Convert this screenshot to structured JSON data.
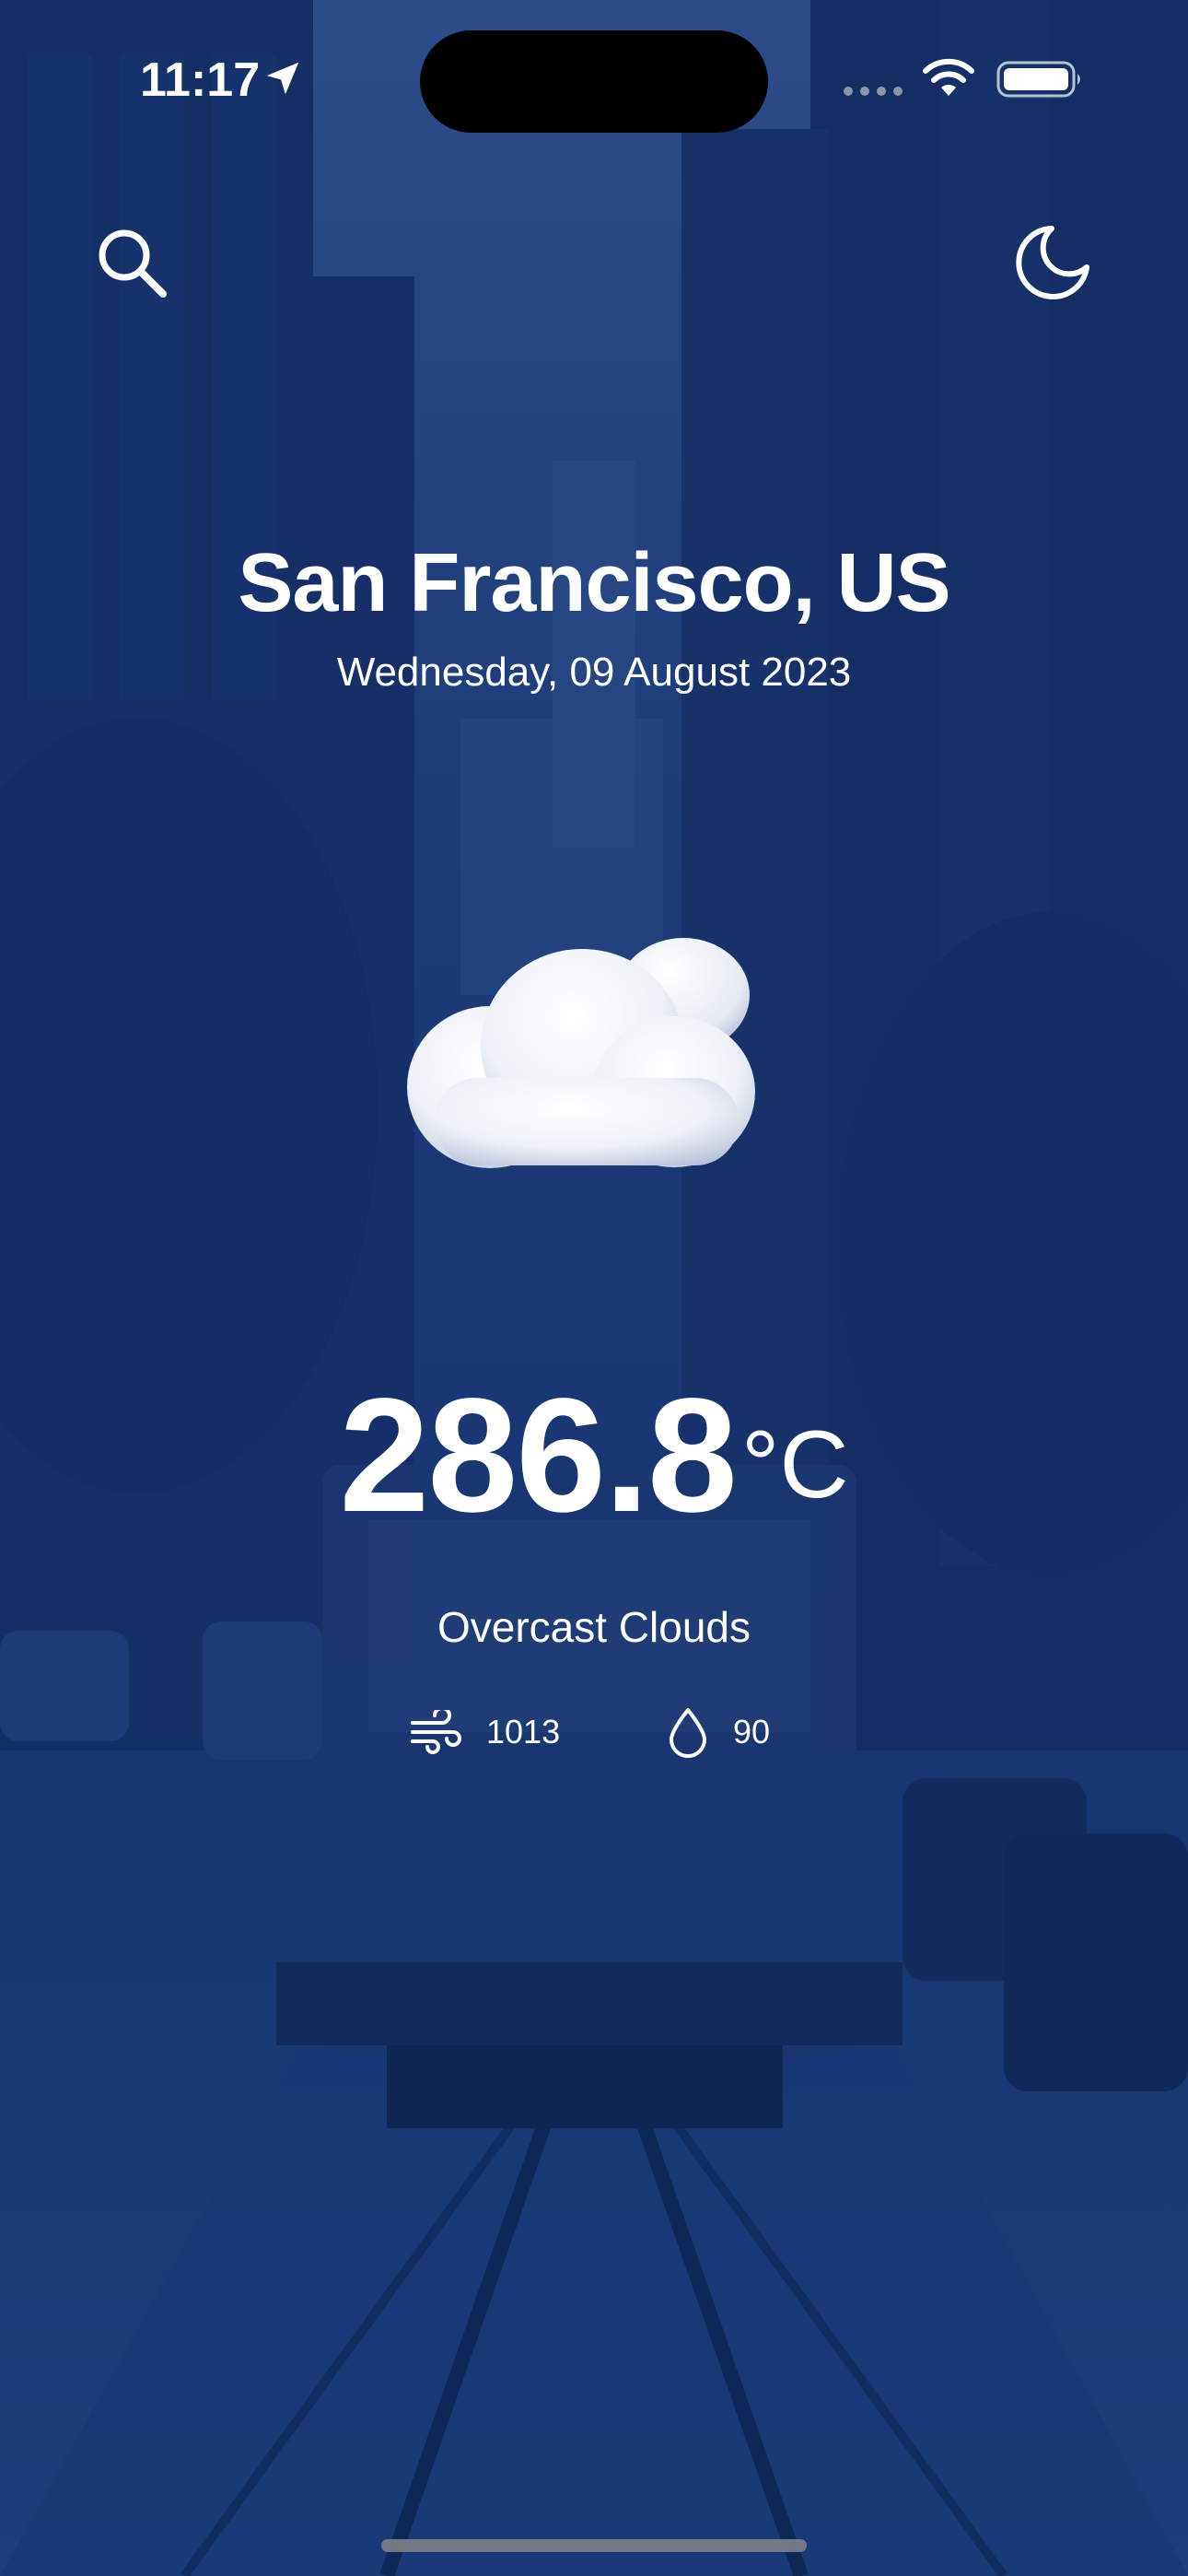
{
  "status_bar": {
    "time": "11:17",
    "icons": [
      "location-arrow-icon",
      "cellular-signal-icon",
      "wifi-icon",
      "battery-icon"
    ]
  },
  "toolbar": {
    "search_icon": "search-icon",
    "theme_icon": "moon-icon"
  },
  "location": {
    "city": "San Francisco, US",
    "date": "Wednesday, 09 August 2023"
  },
  "weather": {
    "icon": "cloud-icon",
    "temperature": "286.8",
    "unit": "°C",
    "condition": "Overcast Clouds",
    "wind": {
      "icon": "wind-icon",
      "value": "1013"
    },
    "humidity": {
      "icon": "droplet-icon",
      "value": "90"
    }
  },
  "colors": {
    "background_tint": "#12306a",
    "text": "#ffffff"
  }
}
